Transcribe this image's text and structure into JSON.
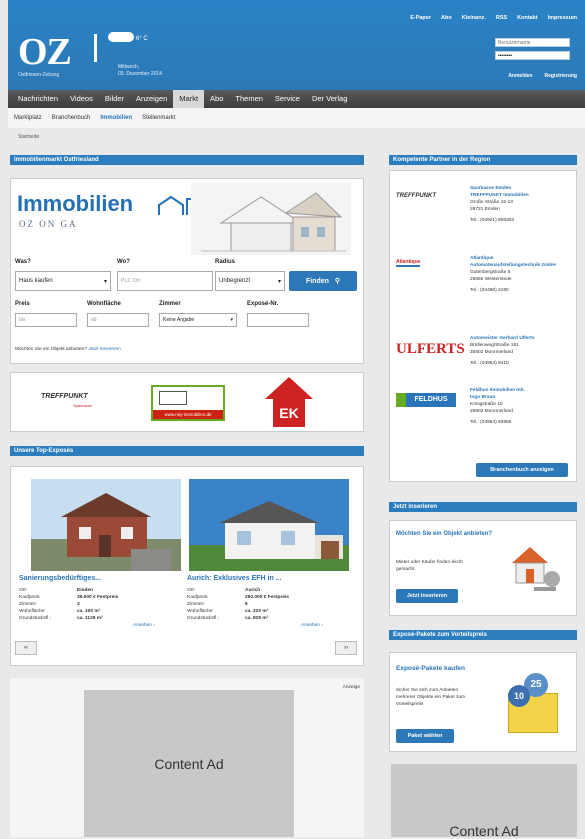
{
  "header": {
    "top_links": [
      "E-Paper",
      "Abo",
      "Kleinanz.",
      "RSS",
      "Kontakt",
      "Impressum"
    ],
    "logo": "OZ",
    "logo_sub": "Ostfriesen-Zeitung",
    "weather": "6° C",
    "date_day": "Mittwoch,",
    "date": "03. Dezember 2014",
    "username_placeholder": "Benutzername",
    "password_value": "••••••••",
    "login": "Anmelden",
    "register": "Registrierung"
  },
  "main_nav": [
    "Nachrichten",
    "Videos",
    "Bilder",
    "Anzeigen",
    "Markt",
    "Abo",
    "Themen",
    "Service",
    "Der Verlag"
  ],
  "sub_nav": [
    "Marktplatz",
    "Branchenbuch",
    "Immobilien",
    "Stellenmarkt"
  ],
  "breadcrumb": "Startseite",
  "immo": {
    "heading": "Immobilienmarkt Ostfriesland",
    "logo": "Immobilien",
    "logo_sub": "OZ  ON  GA",
    "was_label": "Was?",
    "was_value": "Haus kaufen",
    "wo_label": "Wo?",
    "wo_placeholder": "PLZ, Ort",
    "radius_label": "Radius",
    "radius_value": "Unbegrenzt",
    "find": "Finden",
    "preis_label": "Preis",
    "preis_placeholder": "bis",
    "wohnflaeche_label": "Wohnfläche",
    "wohnflaeche_placeholder": "ab",
    "zimmer_label": "Zimmer",
    "zimmer_value": "Keine Angabe",
    "expose_label": "Exposé-Nr.",
    "offer_text": "Möchten Sie ein Objekt anbieten?",
    "offer_link": "Jetzt inserieren"
  },
  "partner_logos": {
    "treffpunkt": "TREFFPUNKT",
    "treffpunkt_sub": "Sparkasse",
    "nsy": "www.nsy-immobilien.de",
    "ek": "EK"
  },
  "top": {
    "heading": "Unsere Top-Exposés",
    "items": [
      {
        "title": "Sanierungsbedürftiges...",
        "ort_label": "Ort:",
        "ort": "Emden",
        "preis_label": "Kaufpreis:",
        "preis": "39.500 € Festpreis",
        "zimmer_label": "Zimmer:",
        "zimmer": "3",
        "wf_label": "Wohnfläche:",
        "wf": "ca. 100 m²",
        "gf_label": "Grundstücksfl.:",
        "gf": "ca. 1129 m²",
        "more": "Ansehen ›"
      },
      {
        "title": "Aurich: Exklusives EFH in ...",
        "ort_label": "Ort:",
        "ort": "Aurich",
        "preis_label": "Kaufpreis:",
        "preis": "290.000 € Festpreis",
        "zimmer_label": "Zimmer:",
        "zimmer": "6",
        "wf_label": "Wohnfläche:",
        "wf": "ca. 220 m²",
        "gf_label": "Grundstücksfl.:",
        "gf": "ca. 829 m²",
        "more": "Ansehen ›"
      }
    ],
    "prev": "‹‹",
    "next": "››"
  },
  "ad": {
    "label": "Anzeige",
    "content": "Content Ad"
  },
  "right": {
    "partners_heading": "Kompetente Partner in der Region",
    "partners": [
      {
        "logo": "TREFFPUNKT",
        "name": "Sparkasse Emden",
        "name2": "TREFFPUNKT Immobilien",
        "addr1": "Große Straße 15-13",
        "addr2": "26721 Emden",
        "tel": "Tel.: (04921) 808303"
      },
      {
        "logo": "Atlantique",
        "name": "Atlantique",
        "name2": "Automatenaufstellungstechnik GmbH",
        "addr1": "Gutenbergstraße 6",
        "addr2": "26655 Westerstede",
        "tel": "Tel.: (04488) 2180"
      },
      {
        "logo": "ULFERTS",
        "name": "Automeister Gerhard Ulferts",
        "name2": "",
        "addr1": "Brüllenweg/Straße 151",
        "addr2": "26802 Moormerland",
        "tel": "Tel.: (04954) 9410"
      },
      {
        "logo": "FELDHUS",
        "name": "Feldhus Immobilien Inh.",
        "name2": "Ingo Braun",
        "addr1": "Königstraße 10",
        "addr2": "26802 Moormerland",
        "tel": "Tel.: (04954) 93955"
      }
    ],
    "branchenbuch": "Branchenbuch anzeigen",
    "insert_heading": "Jetzt inserieren",
    "insert_title": "Möchten Sie ein Objekt anbieten?",
    "insert_text": "Mieter oder Käufer finden leicht gemacht.",
    "insert_btn": "Jetzt inserieren",
    "pakete_heading": "Exposé-Pakete zum Vorteilspreis",
    "pakete_title": "Exposé-Pakete kaufen",
    "pakete_text": "Sicher Sie sich zum Anbieten mehrerer Objekte ein Paket zum Vorteilspreis!",
    "pakete_btn": "Paket wählen",
    "badge1": "25",
    "badge2": "10",
    "ad_content": "Content Ad"
  }
}
